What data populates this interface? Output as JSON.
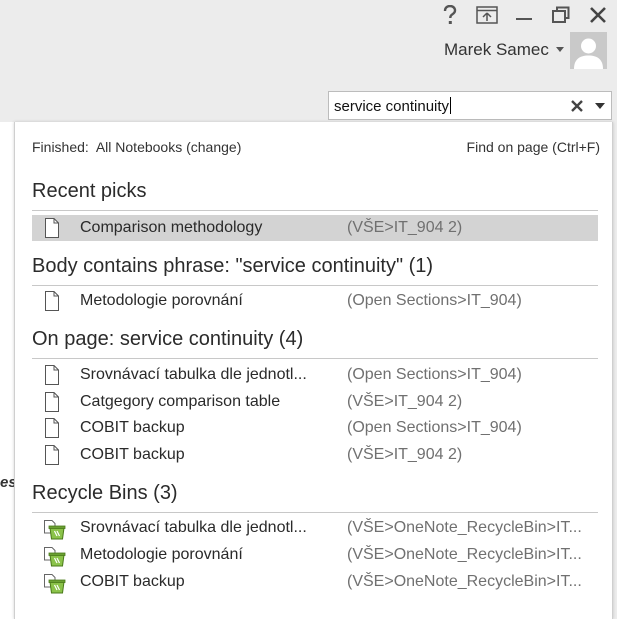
{
  "window": {
    "controls": [
      {
        "name": "help-icon"
      },
      {
        "name": "full-page-icon"
      },
      {
        "name": "minimize-icon"
      },
      {
        "name": "restore-icon"
      },
      {
        "name": "close-icon"
      }
    ]
  },
  "user": {
    "name": "Marek Samec",
    "avatar_icon": "user-avatar-icon"
  },
  "search": {
    "value": "service continuity",
    "clear_icon": "clear-x-icon",
    "dropdown_icon": "chevron-down-icon"
  },
  "left_fragment": "es",
  "panel": {
    "status_label": "Finished:",
    "scope": "All Notebooks",
    "change_link": "(change)",
    "find_on_page": "Find on page (Ctrl+F)",
    "sections": [
      {
        "heading": "Recent picks",
        "items": [
          {
            "title": "Comparison methodology",
            "path": "(VŠE>IT_904 2)",
            "icon": "page-icon",
            "selected": true
          }
        ]
      },
      {
        "heading": "Body contains phrase:  \"service continuity\" (1)",
        "items": [
          {
            "title": "Metodologie porovnání",
            "path": "(Open Sections>IT_904)",
            "icon": "page-icon"
          }
        ]
      },
      {
        "heading": "On page:  service continuity (4)",
        "items": [
          {
            "title": "Srovnávací tabulka dle jednotl...",
            "path": "(Open Sections>IT_904)",
            "icon": "page-icon"
          },
          {
            "title": "Catgegory comparison table",
            "path": "(VŠE>IT_904 2)",
            "icon": "page-icon"
          },
          {
            "title": "COBIT backup",
            "path": "(Open Sections>IT_904)",
            "icon": "page-icon"
          },
          {
            "title": "COBIT backup",
            "path": "(VŠE>IT_904 2)",
            "icon": "page-icon"
          }
        ]
      },
      {
        "heading": "Recycle Bins (3)",
        "items": [
          {
            "title": "Srovnávací tabulka dle jednotl...",
            "path": "(VŠE>OneNote_RecycleBin>IT...",
            "icon": "recycle-bin-icon"
          },
          {
            "title": "Metodologie porovnání",
            "path": "(VŠE>OneNote_RecycleBin>IT...",
            "icon": "recycle-bin-icon"
          },
          {
            "title": "COBIT backup",
            "path": "(VŠE>OneNote_RecycleBin>IT...",
            "icon": "recycle-bin-icon"
          }
        ]
      }
    ]
  }
}
